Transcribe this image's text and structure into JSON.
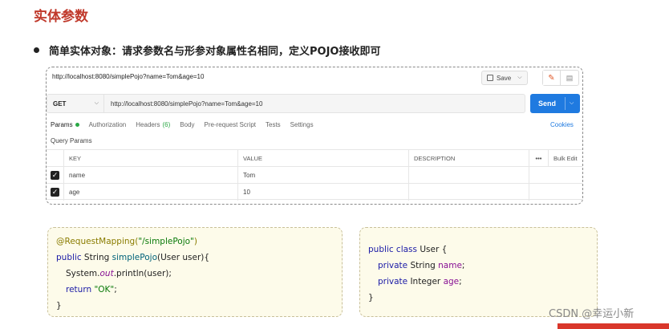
{
  "slide": {
    "title": "实体参数",
    "bullet": "简单实体对象：请求参数名与形参对象属性名相同，定义POJO接收即可"
  },
  "postman": {
    "top_url": "http://localhost:8080/simplePojo?name=Tom&age=10",
    "save_label": "Save",
    "method": "GET",
    "request_url": "http://localhost:8080/simplePojo?name=Tom&age=10",
    "send_label": "Send",
    "tabs": {
      "params": "Params",
      "authorization": "Authorization",
      "headers": "Headers",
      "headers_count": "(6)",
      "body": "Body",
      "prerequest": "Pre-request Script",
      "tests": "Tests",
      "settings": "Settings"
    },
    "cookies_label": "Cookies",
    "query_params_label": "Query Params",
    "table": {
      "col_key": "KEY",
      "col_value": "VALUE",
      "col_description": "DESCRIPTION",
      "more": "•••",
      "bulk_edit": "Bulk Edit",
      "rows": [
        {
          "key": "name",
          "value": "Tom",
          "checked": true
        },
        {
          "key": "age",
          "value": "10",
          "checked": true
        }
      ]
    }
  },
  "code1": {
    "l1_ann": "@RequestMapping(",
    "l1_str": "\"/simplePojo\"",
    "l1_end": ")",
    "l2_kw": "public",
    "l2_type": " String ",
    "l2_meth": "simplePojo",
    "l2_end": "(User user){",
    "l3_a": "System.",
    "l3_out": "out",
    "l3_b": ".println(user);",
    "l4_kw": "return ",
    "l4_str": "\"OK\"",
    "l4_end": ";",
    "l5": "}"
  },
  "code2": {
    "l1_kw": "public class",
    "l1_rest": " User {",
    "l2_kw": "private",
    "l2_type": " String ",
    "l2_fld": "name",
    "l2_end": ";",
    "l3_kw": "private",
    "l3_type": " Integer ",
    "l3_fld": "age",
    "l3_end": ";",
    "l4": "}"
  },
  "watermark": "CSDN @幸运小新",
  "colors": {
    "accent_title": "#c0392b",
    "send_blue": "#1f7ae0",
    "code_bg": "#fdfbea"
  }
}
